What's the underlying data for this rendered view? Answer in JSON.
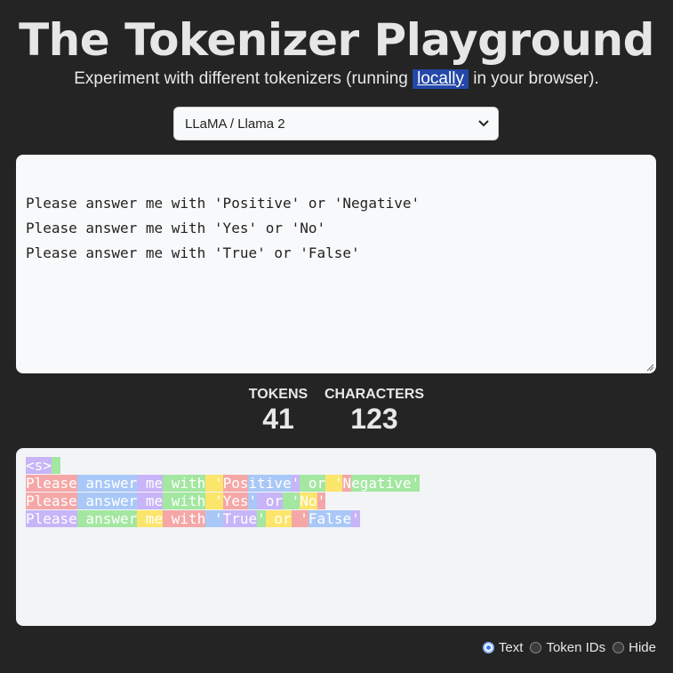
{
  "header": {
    "title": "The Tokenizer Playground",
    "subtitle_before": "Experiment with different tokenizers (running ",
    "subtitle_link": "locally",
    "subtitle_after": " in your browser)."
  },
  "tokenizer_select": {
    "value": "LLaMA / Llama 2"
  },
  "input": {
    "lines": [
      "Please answer me with 'Positive' or 'Negative'",
      "Please answer me with 'Yes' or 'No'",
      "Please answer me with 'True' or 'False'"
    ]
  },
  "stats": {
    "tokens_label": "TOKENS",
    "tokens_value": "41",
    "characters_label": "CHARACTERS",
    "characters_value": "123"
  },
  "output": {
    "lines": [
      [
        {
          "t": "<s>",
          "c": "c0"
        },
        {
          "t": "\n",
          "c": "c1"
        }
      ],
      [
        {
          "t": "Please",
          "c": "c2"
        },
        {
          "t": " answer",
          "c": "c3"
        },
        {
          "t": " me",
          "c": "c0"
        },
        {
          "t": " with",
          "c": "c1"
        },
        {
          "t": " '",
          "c": "c4"
        },
        {
          "t": "Pos",
          "c": "c2"
        },
        {
          "t": "itive",
          "c": "c3"
        },
        {
          "t": "'",
          "c": "c0"
        },
        {
          "t": " or",
          "c": "c1"
        },
        {
          "t": " '",
          "c": "c4"
        },
        {
          "t": "N",
          "c": "c2"
        },
        {
          "t": "egative",
          "c": "c1"
        },
        {
          "t": "'",
          "c": "c1"
        }
      ],
      [
        {
          "t": "Please",
          "c": "c2"
        },
        {
          "t": " answer",
          "c": "c3"
        },
        {
          "t": " me",
          "c": "c0"
        },
        {
          "t": " with",
          "c": "c1"
        },
        {
          "t": " '",
          "c": "c4"
        },
        {
          "t": "Yes",
          "c": "c2"
        },
        {
          "t": "'",
          "c": "c3"
        },
        {
          "t": " or",
          "c": "c0"
        },
        {
          "t": " '",
          "c": "c1"
        },
        {
          "t": "No",
          "c": "c4"
        },
        {
          "t": "'",
          "c": "c2"
        }
      ],
      [
        {
          "t": "Please",
          "c": "c0"
        },
        {
          "t": " answer",
          "c": "c1"
        },
        {
          "t": " me",
          "c": "c4"
        },
        {
          "t": " with",
          "c": "c2"
        },
        {
          "t": " '",
          "c": "c3"
        },
        {
          "t": "True",
          "c": "c0"
        },
        {
          "t": "'",
          "c": "c1"
        },
        {
          "t": " or",
          "c": "c4"
        },
        {
          "t": " '",
          "c": "c2"
        },
        {
          "t": "False",
          "c": "c3"
        },
        {
          "t": "'",
          "c": "c0"
        }
      ]
    ]
  },
  "display_mode": {
    "options": [
      "Text",
      "Token IDs",
      "Hide"
    ],
    "selected": "Text"
  },
  "colors": {
    "token_palette": [
      "#c8b4f8",
      "#a3e7a1",
      "#f5a7a7",
      "#a9c8f7",
      "#fbe56b"
    ],
    "accent": "#2448a8",
    "background": "#242424"
  },
  "icons": {
    "select_chevron": "chevron-down-icon",
    "resize_handle": "resize-grip-icon"
  }
}
